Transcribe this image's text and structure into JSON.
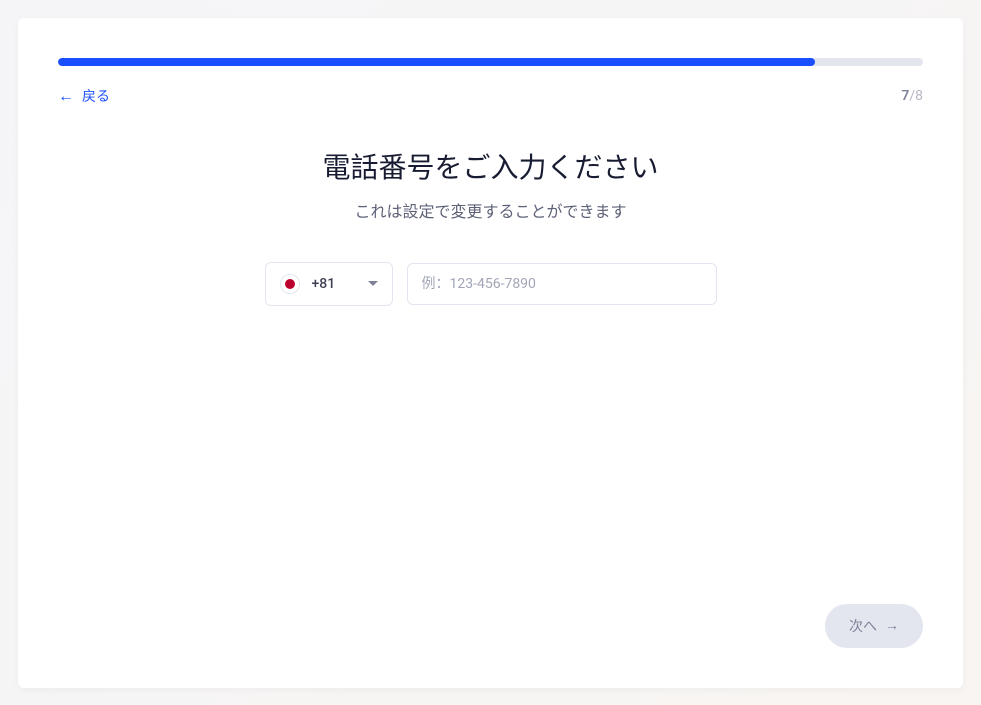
{
  "progress": {
    "current_step": "7",
    "total_steps": "8",
    "separator": "/"
  },
  "navigation": {
    "back_label": "戻る"
  },
  "content": {
    "title": "電話番号をご入力ください",
    "subtitle": "これは設定で変更することができます"
  },
  "phone": {
    "country_code": "+81",
    "country_name": "Japan",
    "placeholder": "例：123-456-7890"
  },
  "actions": {
    "next_label": "次へ"
  },
  "colors": {
    "primary": "#1a4fff",
    "text_dark": "#181c32",
    "text_medium": "#5e6278",
    "text_muted": "#a1a5b7",
    "border": "#e4e6ef",
    "japan_red": "#bc002d"
  }
}
